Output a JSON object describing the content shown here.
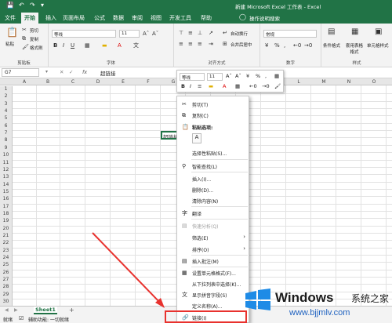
{
  "window": {
    "title": "新建 Microsoft Excel 工作表 - Excel"
  },
  "ribbon_tabs": [
    "文件",
    "开始",
    "插入",
    "页面布局",
    "公式",
    "数据",
    "审阅",
    "视图",
    "开发工具",
    "帮助"
  ],
  "tell_me": "操作说明搜索",
  "ribbon": {
    "clipboard": {
      "paste": "粘贴",
      "cut": "剪切",
      "copy": "复制",
      "format_painter": "格式刷",
      "label": "剪贴板"
    },
    "font": {
      "name": "等线",
      "size": "11",
      "label": "字体"
    },
    "alignment": {
      "wrap": "自动换行",
      "merge": "合并后居中",
      "label": "对齐方式"
    },
    "number": {
      "format": "常规",
      "label": "数字"
    },
    "styles": {
      "conditional": "条件格式",
      "table": "套用表格格式",
      "cell": "单元格样式",
      "label": "样式"
    }
  },
  "formula_bar": {
    "name_box": "G7",
    "fx": "fx",
    "value": "超链接"
  },
  "columns": [
    "A",
    "B",
    "C",
    "D",
    "E",
    "F",
    "G",
    "H",
    "I",
    "J",
    "K",
    "L",
    "M",
    "N",
    "O"
  ],
  "rows": [
    "1",
    "2",
    "3",
    "4",
    "5",
    "6",
    "7",
    "8",
    "9",
    "10",
    "11",
    "12",
    "13",
    "14",
    "15",
    "16",
    "17",
    "18",
    "19",
    "20",
    "21",
    "22",
    "23",
    "24",
    "25",
    "26",
    "27",
    "28",
    "29",
    "30"
  ],
  "cell_G7": "超链接",
  "mini_toolbar": {
    "font": "等线",
    "size": "11"
  },
  "context_menu": {
    "cut": "剪切(T)",
    "copy": "复制(C)",
    "paste_options": "粘贴选项:",
    "paste_special": "选择性粘贴(S)...",
    "smart_lookup": "智能查找(L)",
    "insert": "插入(I)...",
    "delete": "删除(D)...",
    "clear": "清除内容(N)",
    "translate": "翻译",
    "quick_analysis": "快速分析(Q)",
    "filter": "筛选(E)",
    "sort": "排序(O)",
    "insert_comment": "插入批注(M)",
    "format_cells": "设置单元格格式(F)...",
    "pick_list": "从下拉列表中选择(K)...",
    "phonetic": "显示拼音字段(S)",
    "define_name": "定义名称(A)...",
    "link": "链接(I)"
  },
  "sheet": {
    "tab": "Sheet1",
    "add": "+"
  },
  "status": {
    "ready": "就绪",
    "accessibility": "辅助功能: 一切就绪"
  },
  "watermark": {
    "brand": "Windows",
    "cn": "系统之家",
    "url": "www.bjjmlv.com"
  },
  "colors": {
    "excel_green": "#217346",
    "highlight_red": "#e8322e"
  }
}
